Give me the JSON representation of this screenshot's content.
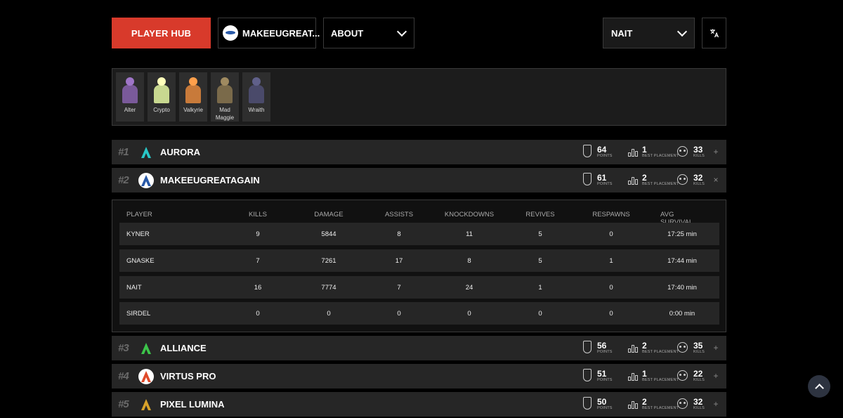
{
  "header": {
    "player_hub": "PLAYER HUB",
    "team_menu": "MAKEEUGREAT...",
    "about": "ABOUT",
    "player_select": "NAIT",
    "lang_icon": "translate-icon"
  },
  "legends": [
    {
      "name": "Alter",
      "color": "#7a5a9a"
    },
    {
      "name": "Crypto",
      "color": "#c8d890"
    },
    {
      "name": "Valkyrie",
      "color": "#c87a3a"
    },
    {
      "name": "Mad\nMaggie",
      "color": "#7a6a4a"
    },
    {
      "name": "Wraith",
      "color": "#4a4a6a"
    }
  ],
  "stat_labels": {
    "points": "POINTS",
    "best_placement": "BEST PLACEMENT",
    "kills": "KILLS"
  },
  "teams": [
    {
      "rank": "#1",
      "name": "AURORA",
      "points": "64",
      "best_placement": "1",
      "kills": "33",
      "toggle": "+",
      "logo_color": "#29c7c7"
    },
    {
      "rank": "#2",
      "name": "MAKEEUGREATAGAIN",
      "points": "61",
      "best_placement": "2",
      "kills": "32",
      "toggle": "×",
      "logo_color": "#2a5aa8"
    },
    {
      "rank": "#3",
      "name": "ALLIANCE",
      "points": "56",
      "best_placement": "2",
      "kills": "35",
      "toggle": "+",
      "logo_color": "#3cc44a"
    },
    {
      "rank": "#4",
      "name": "VIRTUS PRO",
      "points": "51",
      "best_placement": "1",
      "kills": "22",
      "toggle": "+",
      "logo_color": "#e04a2a"
    },
    {
      "rank": "#5",
      "name": "PIXEL LUMINA",
      "points": "50",
      "best_placement": "2",
      "kills": "32",
      "toggle": "+",
      "logo_color": "#d8a22a"
    }
  ],
  "player_table": {
    "headers": [
      "PLAYER",
      "KILLS",
      "DAMAGE",
      "ASSISTS",
      "KNOCKDOWNS",
      "REVIVES",
      "RESPAWNS",
      "AVG SURVIVAL"
    ],
    "rows": [
      [
        "KYNER",
        "9",
        "5844",
        "8",
        "11",
        "5",
        "0",
        "17:25 min"
      ],
      [
        "GNASKE",
        "7",
        "7261",
        "17",
        "8",
        "5",
        "1",
        "17:44 min"
      ],
      [
        "NAIT",
        "16",
        "7774",
        "7",
        "24",
        "1",
        "0",
        "17:40 min"
      ],
      [
        "SIRDEL",
        "0",
        "0",
        "0",
        "0",
        "0",
        "0",
        "0:00 min"
      ]
    ]
  }
}
